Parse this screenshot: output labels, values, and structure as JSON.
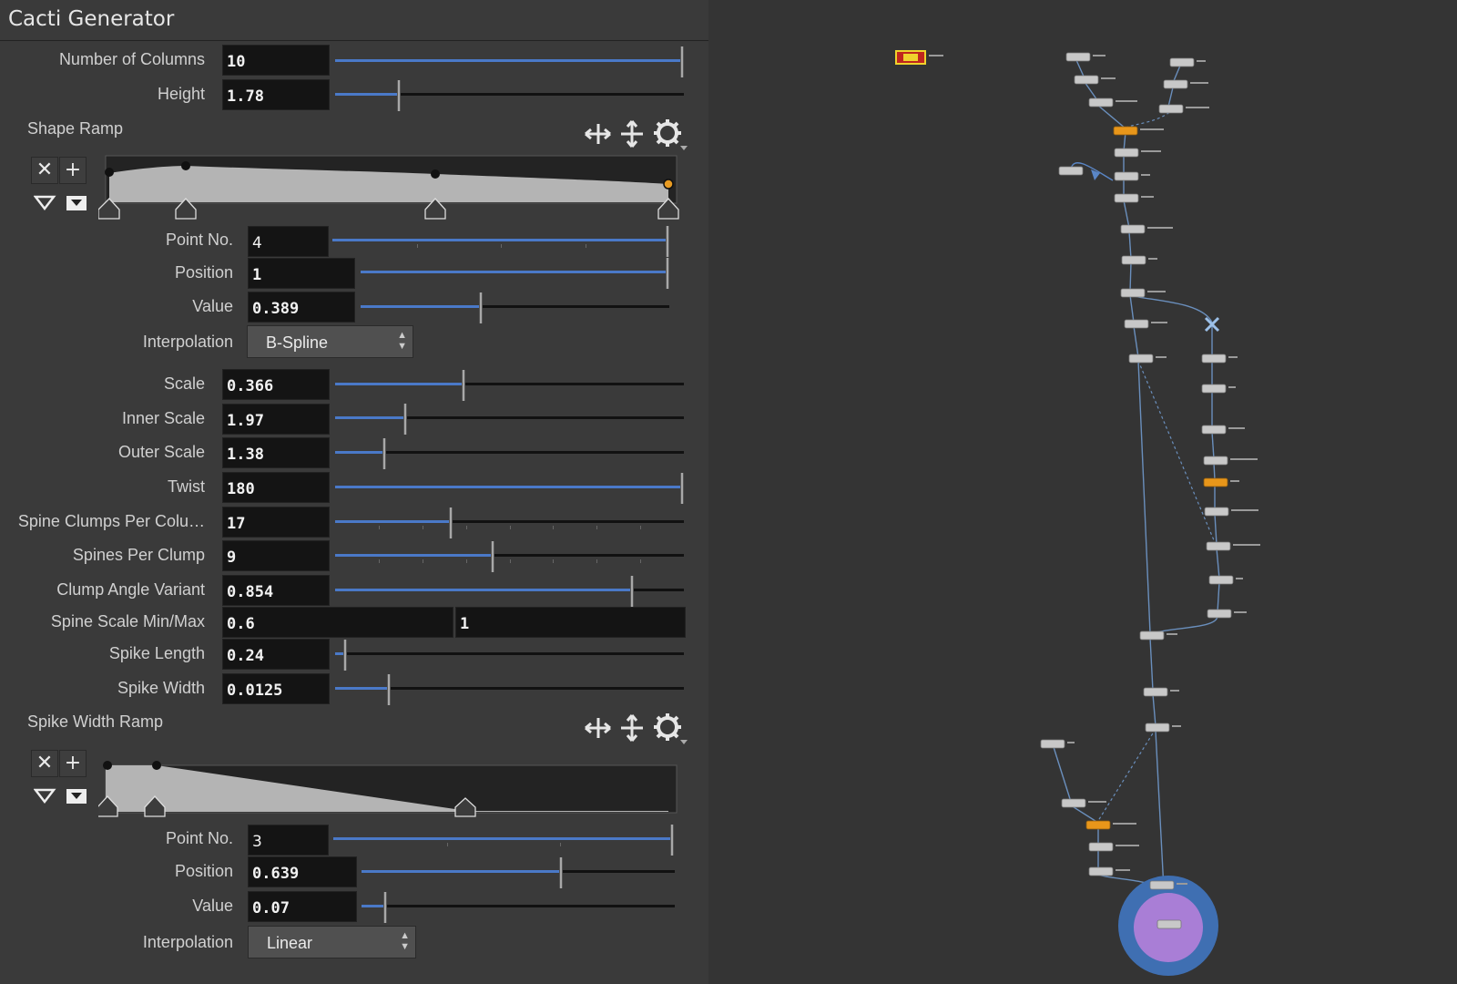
{
  "panel": {
    "title": "Cacti Generator",
    "params": {
      "number_of_columns": {
        "label": "Number of Columns",
        "value": "10",
        "slider": 1.0
      },
      "height": {
        "label": "Height",
        "value": "1.78",
        "slider": 0.18
      },
      "shape_ramp": {
        "label": "Shape Ramp",
        "point_no": {
          "label": "Point No.",
          "value": "4",
          "slider": 1.0
        },
        "position": {
          "label": "Position",
          "value": "1",
          "slider": 1.0
        },
        "value": {
          "label": "Value",
          "value": "0.389",
          "slider": 0.389
        },
        "interpolation": {
          "label": "Interpolation",
          "value": "B-Spline"
        }
      },
      "scale": {
        "label": "Scale",
        "value": "0.366",
        "slider": 0.366
      },
      "inner_scale": {
        "label": "Inner Scale",
        "value": "1.97",
        "slider": 0.197
      },
      "outer_scale": {
        "label": "Outer Scale",
        "value": "1.38",
        "slider": 0.138
      },
      "twist": {
        "label": "Twist",
        "value": "180",
        "slider": 1.0
      },
      "spine_clumps": {
        "label": "Spine Clumps Per Colu…",
        "value": "17",
        "slider": 0.33
      },
      "spines_per_clump": {
        "label": "Spines Per Clump",
        "value": "9",
        "slider": 0.45
      },
      "clump_angle_variant": {
        "label": "Clump Angle Variant",
        "value": "0.854",
        "slider": 0.854
      },
      "spine_scale_minmax": {
        "label": "Spine Scale Min/Max",
        "min": "0.6",
        "max": "1"
      },
      "spike_length": {
        "label": "Spike Length",
        "value": "0.24",
        "slider": 0.024
      },
      "spike_width": {
        "label": "Spike Width",
        "value": "0.0125",
        "slider": 0.15
      },
      "spike_width_ramp": {
        "label": "Spike Width Ramp",
        "point_no": {
          "label": "Point No.",
          "value": "3",
          "slider": 1.0
        },
        "position": {
          "label": "Position",
          "value": "0.639",
          "slider": 0.639
        },
        "value": {
          "label": "Value",
          "value": "0.07",
          "slider": 0.07
        },
        "interpolation": {
          "label": "Interpolation",
          "value": "Linear"
        }
      }
    }
  },
  "colors": {
    "panel_bg": "#3a3a3a",
    "network_bg": "#343434",
    "slider_fill": "#4a79c8",
    "ramp_fill": "#b4b4b4",
    "selected_point": "#e89b22",
    "orange_node": "#e8961a",
    "display_ring": "#3f6fb2",
    "display_core": "#a97ed6"
  },
  "icons": [
    "close-icon",
    "plus-icon",
    "triangle-down-icon",
    "download-box-icon",
    "arrows-horizontal-icon",
    "arrows-vertical-icon",
    "gear-icon"
  ]
}
